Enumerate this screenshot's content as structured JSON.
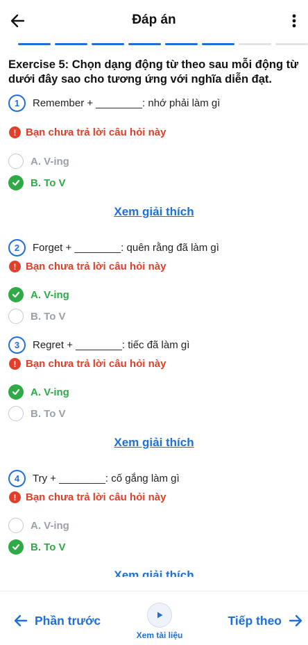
{
  "header": {
    "title": "Đáp án"
  },
  "progress": {
    "total_segments": 8,
    "completed_segments": 6
  },
  "exercise": {
    "title": "Exercise 5: Chọn dạng động từ theo sau mỗi động từ dưới đây sao cho tương ứng với nghĩa diễn đạt.",
    "warning_text": "Bạn chưa trả lời câu hỏi này",
    "explain_label": "Xem giải thích",
    "questions": [
      {
        "number": "1",
        "text": "Remember + ________: nhớ phải làm gì",
        "options": [
          {
            "label": "A. V-ing",
            "correct": false
          },
          {
            "label": "B. To V",
            "correct": true
          }
        ]
      },
      {
        "number": "2",
        "text": "Forget + ________: quên rằng đã làm gì",
        "options": [
          {
            "label": "A. V-ing",
            "correct": true
          },
          {
            "label": "B. To V",
            "correct": false
          }
        ]
      },
      {
        "number": "3",
        "text": "Regret + ________: tiếc đã làm gì",
        "options": [
          {
            "label": "A. V-ing",
            "correct": true
          },
          {
            "label": "B. To V",
            "correct": false
          }
        ]
      },
      {
        "number": "4",
        "text": "Try + ________: cố gắng làm gì",
        "options": [
          {
            "label": "A. V-ing",
            "correct": false
          },
          {
            "label": "B. To V",
            "correct": true
          }
        ]
      }
    ]
  },
  "footer": {
    "prev_label": "Phần trước",
    "doc_label": "Xem tài liệu",
    "next_label": "Tiếp theo"
  },
  "colors": {
    "accent": "#1e6fd9",
    "error": "#e0402b",
    "correct": "#2eaa46",
    "muted": "#9aa1a9"
  }
}
